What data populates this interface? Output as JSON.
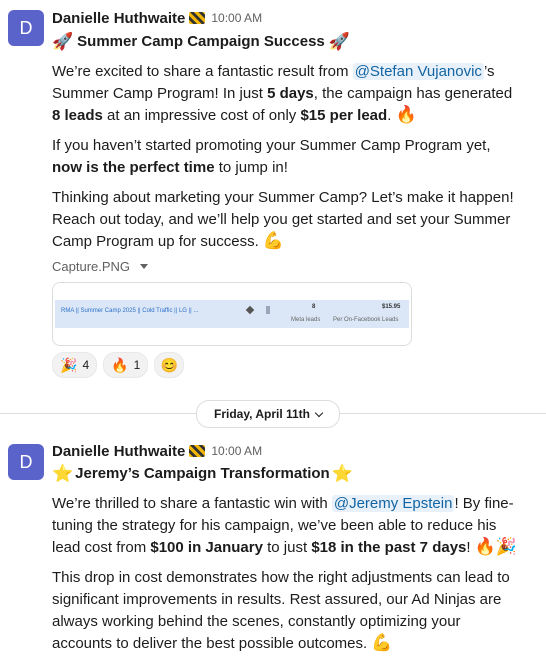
{
  "message1": {
    "avatar_letter": "D",
    "author": "Danielle Huthwaite",
    "time": "10:00 AM",
    "title_text": "Summer Camp Campaign Success",
    "title_emoji_left": "🚀",
    "title_emoji_right": "🚀",
    "p1_a": "We’re excited to share a fantastic result from ",
    "p1_mention": "@Stefan Vujanovic",
    "p1_b": "’s Summer Camp Program! In just ",
    "p1_bold1": "5 days",
    "p1_c": ", the campaign has generated ",
    "p1_bold2": "8 leads",
    "p1_d": " at an impressive cost of only ",
    "p1_bold3": "$15 per lead",
    "p1_e": ".",
    "p1_emoji": "🔥",
    "p2_a": "If you haven’t started promoting your Summer Camp Program yet, ",
    "p2_bold": "now is the perfect time",
    "p2_b": " to jump in!",
    "p3": "Thinking about marketing your Summer Camp? Let’s make it happen! Reach out today, and we’ll help you get started and set your Summer Camp Program up for success.",
    "p3_emoji": "💪",
    "file_name": "Capture.PNG",
    "preview": {
      "campaign": "RMA || Summer Camp 2025 || Cold Traffic || LG || ...",
      "value1": "8",
      "label1": "Meta leads",
      "value2": "$15.95",
      "label2": "Per On-Facebook Leads"
    },
    "reactions": [
      {
        "emoji": "🎉",
        "count": "4"
      },
      {
        "emoji": "🔥",
        "count": "1"
      }
    ],
    "add_reaction_icon": "😊"
  },
  "date_divider": "Friday, April 11th",
  "message2": {
    "avatar_letter": "D",
    "author": "Danielle Huthwaite",
    "time": "10:00 AM",
    "title_text": "Jeremy’s Campaign Transformation",
    "title_emoji_left": "⭐",
    "title_emoji_right": "⭐",
    "p1_a": "We’re thrilled to share a fantastic win with ",
    "p1_mention": "@Jeremy Epstein",
    "p1_b": "! By fine-tuning the strategy for his campaign, we’ve been able to reduce his lead cost from ",
    "p1_bold1": "$100 in January",
    "p1_c": " to just ",
    "p1_bold2": "$18 in the past 7 days",
    "p1_d": "!",
    "p1_emoji1": "🔥",
    "p1_emoji2": "🎉",
    "p2": "This drop in cost demonstrates how the right adjustments can lead to significant improvements in results. Rest assured, our Ad Ninjas are always working behind the scenes, constantly optimizing your accounts to deliver the best possible outcomes.",
    "p2_emoji": "💪"
  }
}
